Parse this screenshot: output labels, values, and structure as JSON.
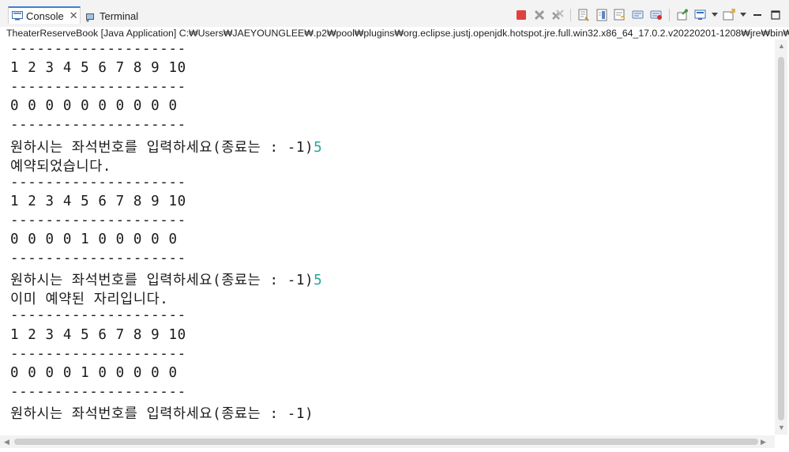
{
  "tabs": [
    {
      "label": "Console",
      "icon": "console-icon",
      "active": true
    },
    {
      "label": "Terminal",
      "icon": "terminal-icon",
      "active": false
    }
  ],
  "toolbar_icons": [
    "terminate-icon",
    "remove-launch-icon",
    "remove-all-icon",
    "clear-console-icon",
    "scroll-lock-icon",
    "word-wrap-icon",
    "show-on-output-icon",
    "show-on-error-icon",
    "pin-console-icon",
    "display-selected-console-icon",
    "open-console-icon",
    "minimize-icon",
    "maximize-icon"
  ],
  "process_path": "TheaterReserveBook [Java Application] C:₩Users₩JAEYOUNGLEE₩.p2₩pool₩plugins₩org.eclipse.justj.openjdk.hotspot.jre.full.win32.x86_64_17.0.2.v20220201-1208₩jre₩bin₩javaw.exe",
  "console": {
    "lines": [
      {
        "text": "--------------------",
        "input": ""
      },
      {
        "text": "1 2 3 4 5 6 7 8 9 10",
        "input": ""
      },
      {
        "text": "--------------------",
        "input": ""
      },
      {
        "text": "0 0 0 0 0 0 0 0 0 0",
        "input": ""
      },
      {
        "text": "--------------------",
        "input": ""
      },
      {
        "text": "원하시는 좌석번호를 입력하세요(종료는 : -1)",
        "input": "5"
      },
      {
        "text": "예약되었습니다.",
        "input": ""
      },
      {
        "text": "--------------------",
        "input": ""
      },
      {
        "text": "1 2 3 4 5 6 7 8 9 10",
        "input": ""
      },
      {
        "text": "--------------------",
        "input": ""
      },
      {
        "text": "0 0 0 0 1 0 0 0 0 0",
        "input": ""
      },
      {
        "text": "--------------------",
        "input": ""
      },
      {
        "text": "원하시는 좌석번호를 입력하세요(종료는 : -1)",
        "input": "5"
      },
      {
        "text": "이미 예약된 자리입니다.",
        "input": ""
      },
      {
        "text": "--------------------",
        "input": ""
      },
      {
        "text": "1 2 3 4 5 6 7 8 9 10",
        "input": ""
      },
      {
        "text": "--------------------",
        "input": ""
      },
      {
        "text": "0 0 0 0 1 0 0 0 0 0",
        "input": ""
      },
      {
        "text": "--------------------",
        "input": ""
      },
      {
        "text": "원하시는 좌석번호를 입력하세요(종료는 : -1)",
        "input": ""
      }
    ]
  },
  "colors": {
    "input_text": "#26a69a",
    "terminate": "#e04040",
    "active_tab_border": "#3c7fd4"
  }
}
